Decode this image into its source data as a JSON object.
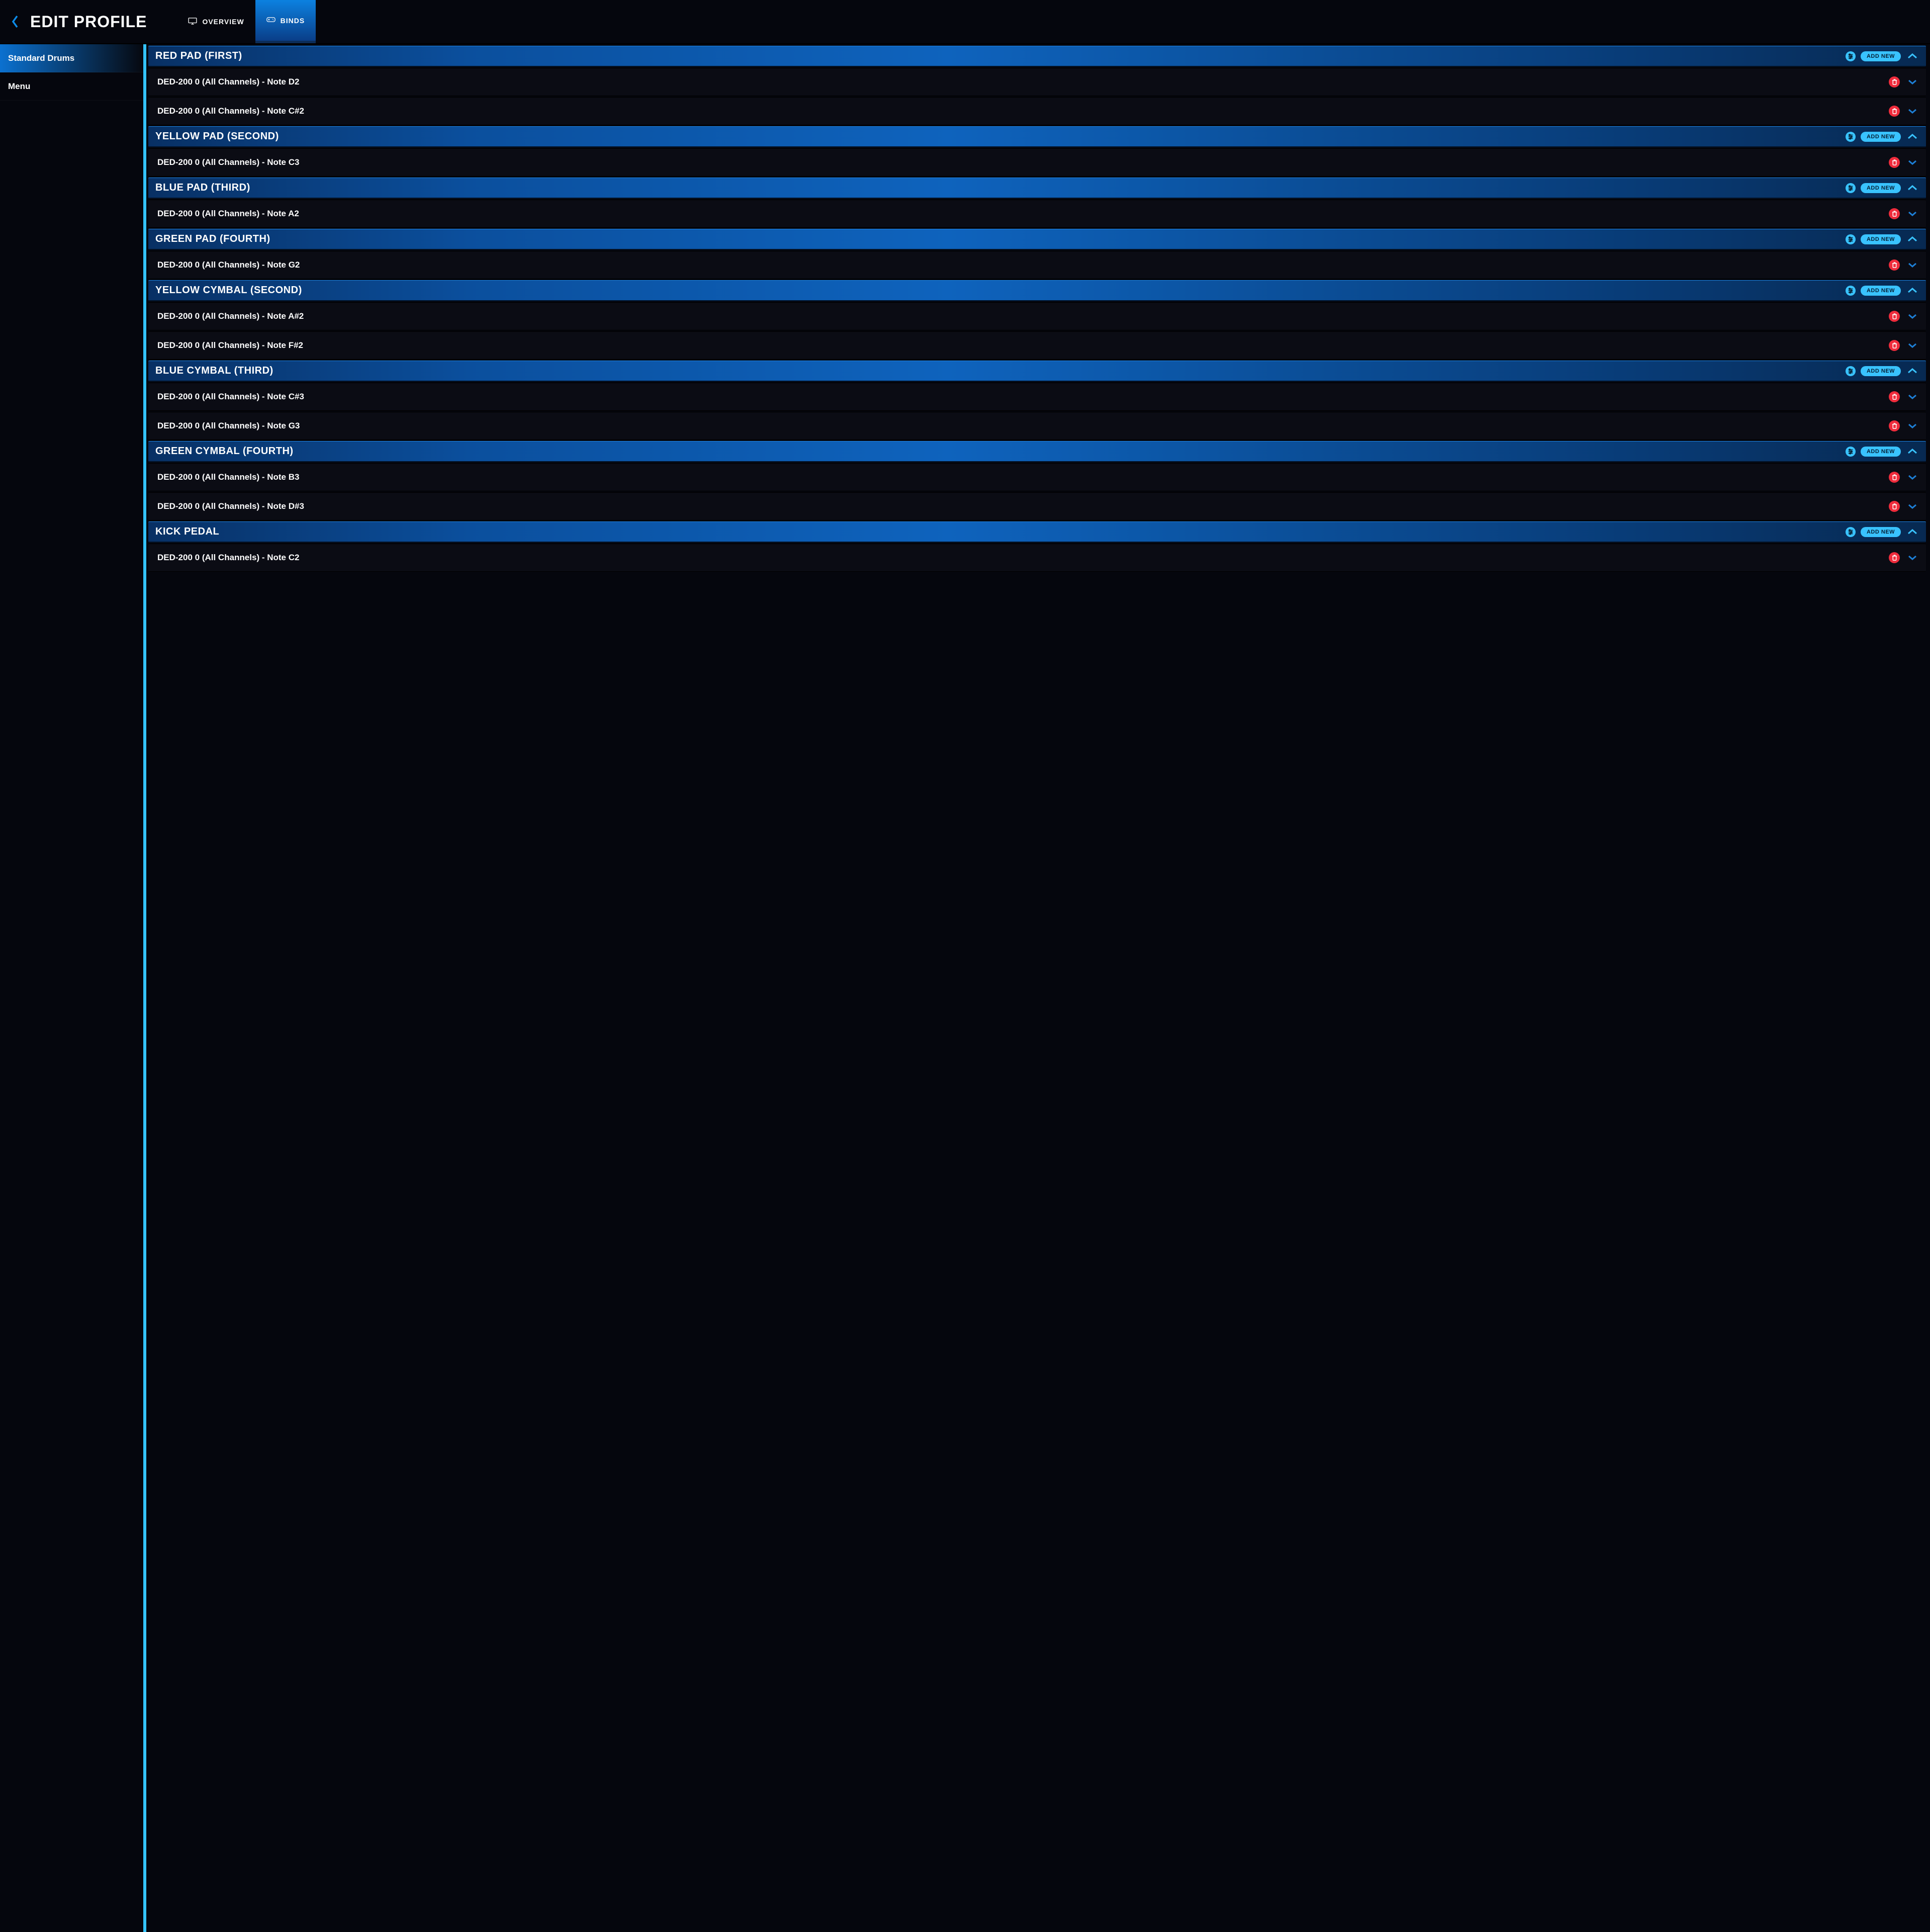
{
  "header": {
    "title": "EDIT PROFILE",
    "tabs": [
      {
        "id": "overview",
        "label": "OVERVIEW",
        "icon": "monitor",
        "active": false
      },
      {
        "id": "binds",
        "label": "BINDS",
        "icon": "gamepad",
        "active": true
      }
    ]
  },
  "sidebar": {
    "items": [
      {
        "id": "standard-drums",
        "label": "Standard Drums",
        "active": true
      },
      {
        "id": "menu",
        "label": "Menu",
        "active": false
      }
    ]
  },
  "add_new_label": "ADD NEW",
  "sections": [
    {
      "title": "RED PAD (FIRST)",
      "binds": [
        "DED-200 0 (All Channels) - Note D2",
        "DED-200 0 (All Channels) - Note C#2"
      ]
    },
    {
      "title": "YELLOW PAD (SECOND)",
      "binds": [
        "DED-200 0 (All Channels) - Note C3"
      ]
    },
    {
      "title": "BLUE PAD (THIRD)",
      "binds": [
        "DED-200 0 (All Channels) - Note A2"
      ]
    },
    {
      "title": "GREEN PAD (FOURTH)",
      "binds": [
        "DED-200 0 (All Channels) - Note G2"
      ]
    },
    {
      "title": "YELLOW CYMBAL (SECOND)",
      "binds": [
        "DED-200 0 (All Channels) - Note A#2",
        "DED-200 0 (All Channels) - Note F#2"
      ]
    },
    {
      "title": "BLUE CYMBAL (THIRD)",
      "binds": [
        "DED-200 0 (All Channels) - Note C#3",
        "DED-200 0 (All Channels) - Note G3"
      ]
    },
    {
      "title": "GREEN CYMBAL (FOURTH)",
      "binds": [
        "DED-200 0 (All Channels) - Note B3",
        "DED-200 0 (All Channels) - Note D#3"
      ]
    },
    {
      "title": "KICK PEDAL",
      "binds": [
        "DED-200 0 (All Channels) - Note C2"
      ]
    }
  ]
}
